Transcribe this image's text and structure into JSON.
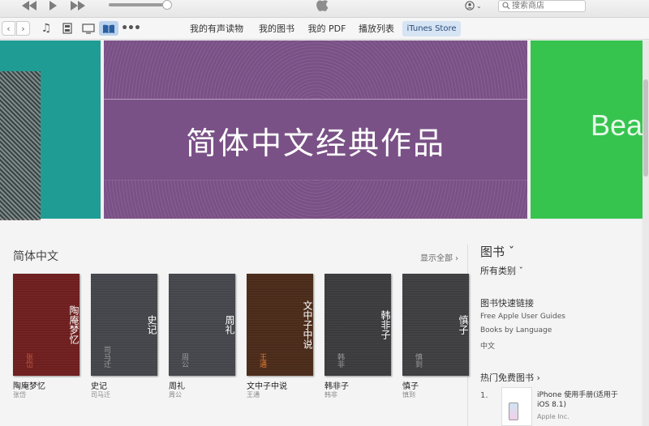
{
  "search": {
    "placeholder": "搜索商店"
  },
  "nav": {
    "back_label": "‹",
    "forward_label": "›",
    "tabs": [
      "我的有声读物",
      "我的图书",
      "我的 PDF",
      "播放列表",
      "iTunes Store"
    ]
  },
  "banner": {
    "title": "简体中文经典作品",
    "right_text": "Bea"
  },
  "section": {
    "title": "简体中文",
    "show_all": "显示全部 ›"
  },
  "books": [
    {
      "cover_title": "陶庵梦忆",
      "cover_author": "张岱",
      "title": "陶庵梦忆",
      "author": "张岱"
    },
    {
      "cover_title": "史记",
      "cover_author": "司马迁",
      "title": "史记",
      "author": "司马迁"
    },
    {
      "cover_title": "周礼",
      "cover_author": "周公",
      "title": "周礼",
      "author": "周公"
    },
    {
      "cover_title": "文中子中说",
      "cover_author": "王通",
      "title": "文中子中说",
      "author": "王通"
    },
    {
      "cover_title": "韩非子",
      "cover_author": "韩非",
      "title": "韩非子",
      "author": "韩非"
    },
    {
      "cover_title": "慎子",
      "cover_author": "慎到",
      "title": "慎子",
      "author": "慎到"
    }
  ],
  "sidebar": {
    "heading": "图书 ˇ",
    "category": "所有类别 ˇ",
    "quick_links_title": "图书快速链接",
    "links": [
      "Free Apple User Guides",
      "Books by Language",
      "中文"
    ],
    "free_title": "热门免费图书 ›",
    "free_item": {
      "rank": "1.",
      "title": "iPhone 使用手册(适用于 iOS 8.1)",
      "publisher": "Apple Inc."
    }
  },
  "colors": {
    "banner_purple": "#7a5186",
    "banner_teal": "#1f9c94",
    "banner_green": "#36c44f",
    "tab_selected": "#d6e4f4"
  }
}
